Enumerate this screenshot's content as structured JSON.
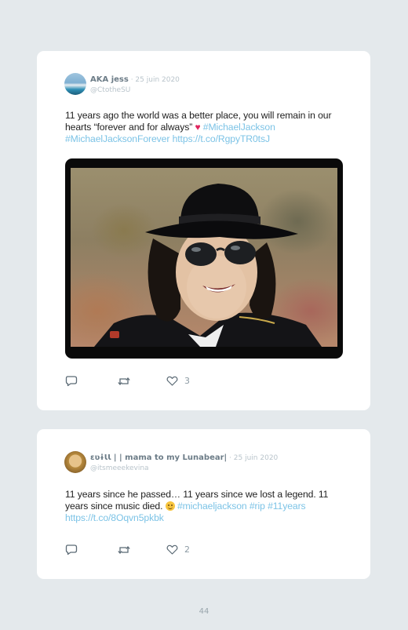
{
  "tweets": [
    {
      "display_name": "AKA jess",
      "date": "25 juin 2020",
      "handle": "@CtotheSU",
      "text_plain": "11 years ago the world was a better place, you will remain in our hearts “forever and for always” ",
      "emoji": "heart",
      "hashtags": [
        "#MichaelJackson",
        "#MichaelJacksonForever"
      ],
      "link": "https://t.co/RgpyTR0tsJ",
      "likes": "3"
    },
    {
      "display_name": "ɛʋɨƖƖ | | mama to my Lunabear|",
      "date": "25 juin 2020",
      "handle": "@itsmeeekevina",
      "text_plain": "11 years since he passed… 11 years since we lost a legend. 11 years since music died. ",
      "emoji": "smile",
      "hashtags": [
        "#michaeljackson",
        "#rip",
        "#11years"
      ],
      "link": "https://t.co/8Oqvn5pkbk",
      "likes": "2"
    }
  ],
  "separator": " · ",
  "page_number": "44",
  "colors": {
    "background": "#e4e9ec",
    "card": "#ffffff",
    "link": "#7cc3e6",
    "heart": "#e0245e"
  },
  "icons": [
    "reply-icon",
    "retweet-icon",
    "like-icon"
  ]
}
